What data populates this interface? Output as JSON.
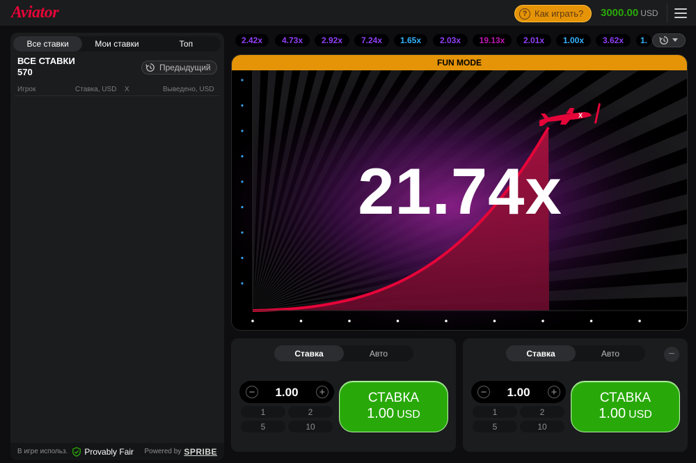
{
  "header": {
    "logo": "Aviator",
    "how_to_play": "Как играть?",
    "balance": "3000.00",
    "currency": "USD"
  },
  "left_panel": {
    "tabs": [
      {
        "label": "Все ставки",
        "active": true
      },
      {
        "label": "Мои ставки",
        "active": false
      },
      {
        "label": "Топ",
        "active": false
      }
    ],
    "all_bets_title": "ВСЕ СТАВКИ",
    "all_bets_count": "570",
    "previous_button": "Предыдущий",
    "columns": {
      "player": "Игрок",
      "bet": "Ставка, USD",
      "x": "X",
      "cashout": "Выведено, USD"
    },
    "footer": {
      "uses": "В игре использ.",
      "provably_fair": "Provably Fair",
      "powered_by": "Powered by",
      "brand": "SPRIBE"
    }
  },
  "history": [
    {
      "value": "2.42x",
      "color": "#913ef8"
    },
    {
      "value": "4.73x",
      "color": "#913ef8"
    },
    {
      "value": "2.92x",
      "color": "#913ef8"
    },
    {
      "value": "7.24x",
      "color": "#913ef8"
    },
    {
      "value": "1.65x",
      "color": "#34b4ff"
    },
    {
      "value": "2.03x",
      "color": "#913ef8"
    },
    {
      "value": "19.13x",
      "color": "#c017b4"
    },
    {
      "value": "2.01x",
      "color": "#913ef8"
    },
    {
      "value": "1.00x",
      "color": "#34b4ff"
    },
    {
      "value": "3.62x",
      "color": "#913ef8"
    },
    {
      "value": "1.",
      "color": "#34b4ff"
    }
  ],
  "game": {
    "mode_banner": "FUN MODE",
    "multiplier": "21.74x",
    "accent_color": "#e50539"
  },
  "bets": [
    {
      "tab_bet": "Ставка",
      "tab_auto": "Авто",
      "amount": "1.00",
      "quick": [
        "1",
        "2",
        "5",
        "10"
      ],
      "button_title": "СТАВКА",
      "button_amount": "1.00",
      "button_currency": "USD"
    },
    {
      "tab_bet": "Ставка",
      "tab_auto": "Авто",
      "amount": "1.00",
      "quick": [
        "1",
        "2",
        "5",
        "10"
      ],
      "button_title": "СТАВКА",
      "button_amount": "1.00",
      "button_currency": "USD"
    }
  ]
}
